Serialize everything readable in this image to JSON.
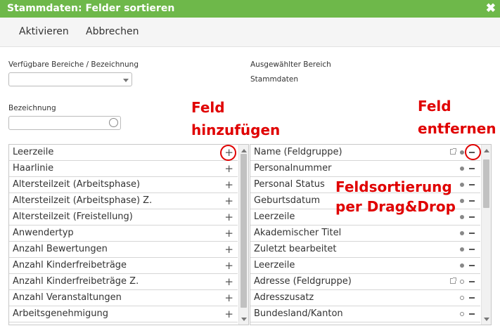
{
  "window": {
    "title": "Stammdaten: Felder sortieren",
    "close_glyph": "✖"
  },
  "toolbar": {
    "activate_label": "Aktivieren",
    "cancel_label": "Abbrechen"
  },
  "left_form": {
    "areas_label": "Verfügbare Bereiche / Bezeichnung",
    "areas_value": "",
    "name_label": "Bezeichnung",
    "name_value": ""
  },
  "right_form": {
    "selected_area_label": "Ausgewählter Bereich",
    "selected_area_value": "Stammdaten"
  },
  "annotations": {
    "add_line1": "Feld",
    "add_line2": "hinzufügen",
    "remove_line1": "Feld",
    "remove_line2": "entfernen",
    "sort_line1": "Feldsortierung",
    "sort_line2": "per Drag&Drop",
    "color": "#e00000"
  },
  "colors": {
    "titlebar": "#6eb84a"
  },
  "available_fields": [
    "Leerzeile",
    "Haarlinie",
    "Altersteilzeit (Arbeitsphase)",
    "Altersteilzeit (Arbeitsphase) Z.",
    "Altersteilzeit (Freistellung)",
    "Anwendertyp",
    "Anzahl Bewertungen",
    "Anzahl Kinderfreibeträge",
    "Anzahl Kinderfreibeträge Z.",
    "Anzahl Veranstaltungen",
    "Arbeitsgenehmigung"
  ],
  "selected_fields": [
    {
      "label": "Name (Feldgruppe)",
      "group": true,
      "dot": "filled"
    },
    {
      "label": "Personalnummer",
      "group": false,
      "dot": "filled"
    },
    {
      "label": "Personal Status",
      "group": false,
      "dot": "filled"
    },
    {
      "label": "Geburtsdatum",
      "group": false,
      "dot": "filled"
    },
    {
      "label": "Leerzeile",
      "group": false,
      "dot": "filled"
    },
    {
      "label": "Akademischer Titel",
      "group": false,
      "dot": "filled"
    },
    {
      "label": "Zuletzt bearbeitet",
      "group": false,
      "dot": "filled"
    },
    {
      "label": "Leerzeile",
      "group": false,
      "dot": "filled"
    },
    {
      "label": "Adresse (Feldgruppe)",
      "group": true,
      "dot": "hollow"
    },
    {
      "label": "Adresszusatz",
      "group": false,
      "dot": "hollow"
    },
    {
      "label": "Bundesland/Kanton",
      "group": false,
      "dot": "hollow"
    }
  ],
  "left_scroll": {
    "position_fraction": 0.0,
    "visible_fraction": 0.95
  },
  "right_scroll": {
    "position_fraction": 0.05,
    "visible_fraction": 0.3
  }
}
